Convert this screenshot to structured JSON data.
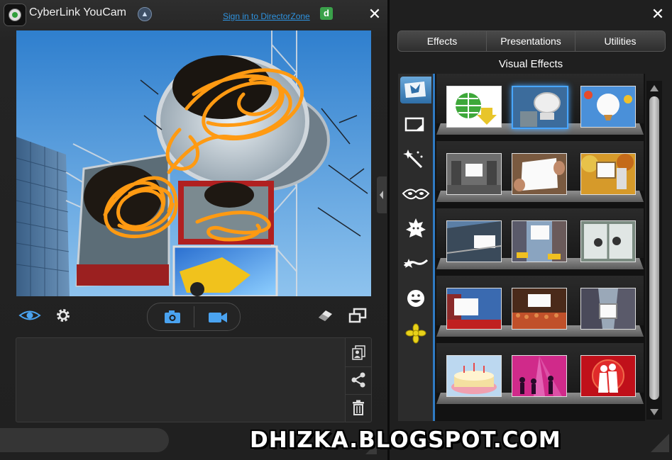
{
  "app": {
    "title": "CyberLink YouCam",
    "signin_link": "Sign in to DirectorZone",
    "directorzone_letter": "d"
  },
  "preview": {
    "description_icons": [
      "billboard-scene",
      "orange-scribble"
    ]
  },
  "controls": {
    "left": [
      "eye-icon",
      "gear-icon"
    ],
    "capture": [
      "camera-icon",
      "video-icon"
    ],
    "right": [
      "eraser-icon",
      "fullscreen-icon"
    ]
  },
  "tray": {
    "side_buttons": [
      "import-icon",
      "share-icon",
      "trash-icon"
    ]
  },
  "panel": {
    "tabs": [
      "Effects",
      "Presentations",
      "Utilities"
    ],
    "active_tab": "Effects",
    "section_title": "Visual Effects",
    "categories": [
      "visual-effects-icon",
      "frame-icon",
      "magic-wand-icon",
      "mask-icon",
      "avatar-icon",
      "particle-icon",
      "emotion-icon",
      "gadget-icon"
    ],
    "selected_category": 0,
    "thumbnails": [
      [
        "globe-download",
        "billboard-sign",
        "hot-air-balloon"
      ],
      [
        "subway-billboard",
        "hands-frame",
        "autumn-painting"
      ],
      [
        "rail-platform",
        "times-square",
        "window-washers"
      ],
      [
        "city-screen",
        "stadium-crowd",
        "skyscraper-screen"
      ],
      [
        "birthday-cake",
        "pink-party",
        "red-romance"
      ]
    ],
    "selected_thumbnail": [
      0,
      1
    ]
  },
  "watermark": "DHIZKA.BLOGSPOT.COM",
  "colors": {
    "accent": "#2f7bc4",
    "scribble": "#ff9a12",
    "link": "#2e93e0"
  }
}
